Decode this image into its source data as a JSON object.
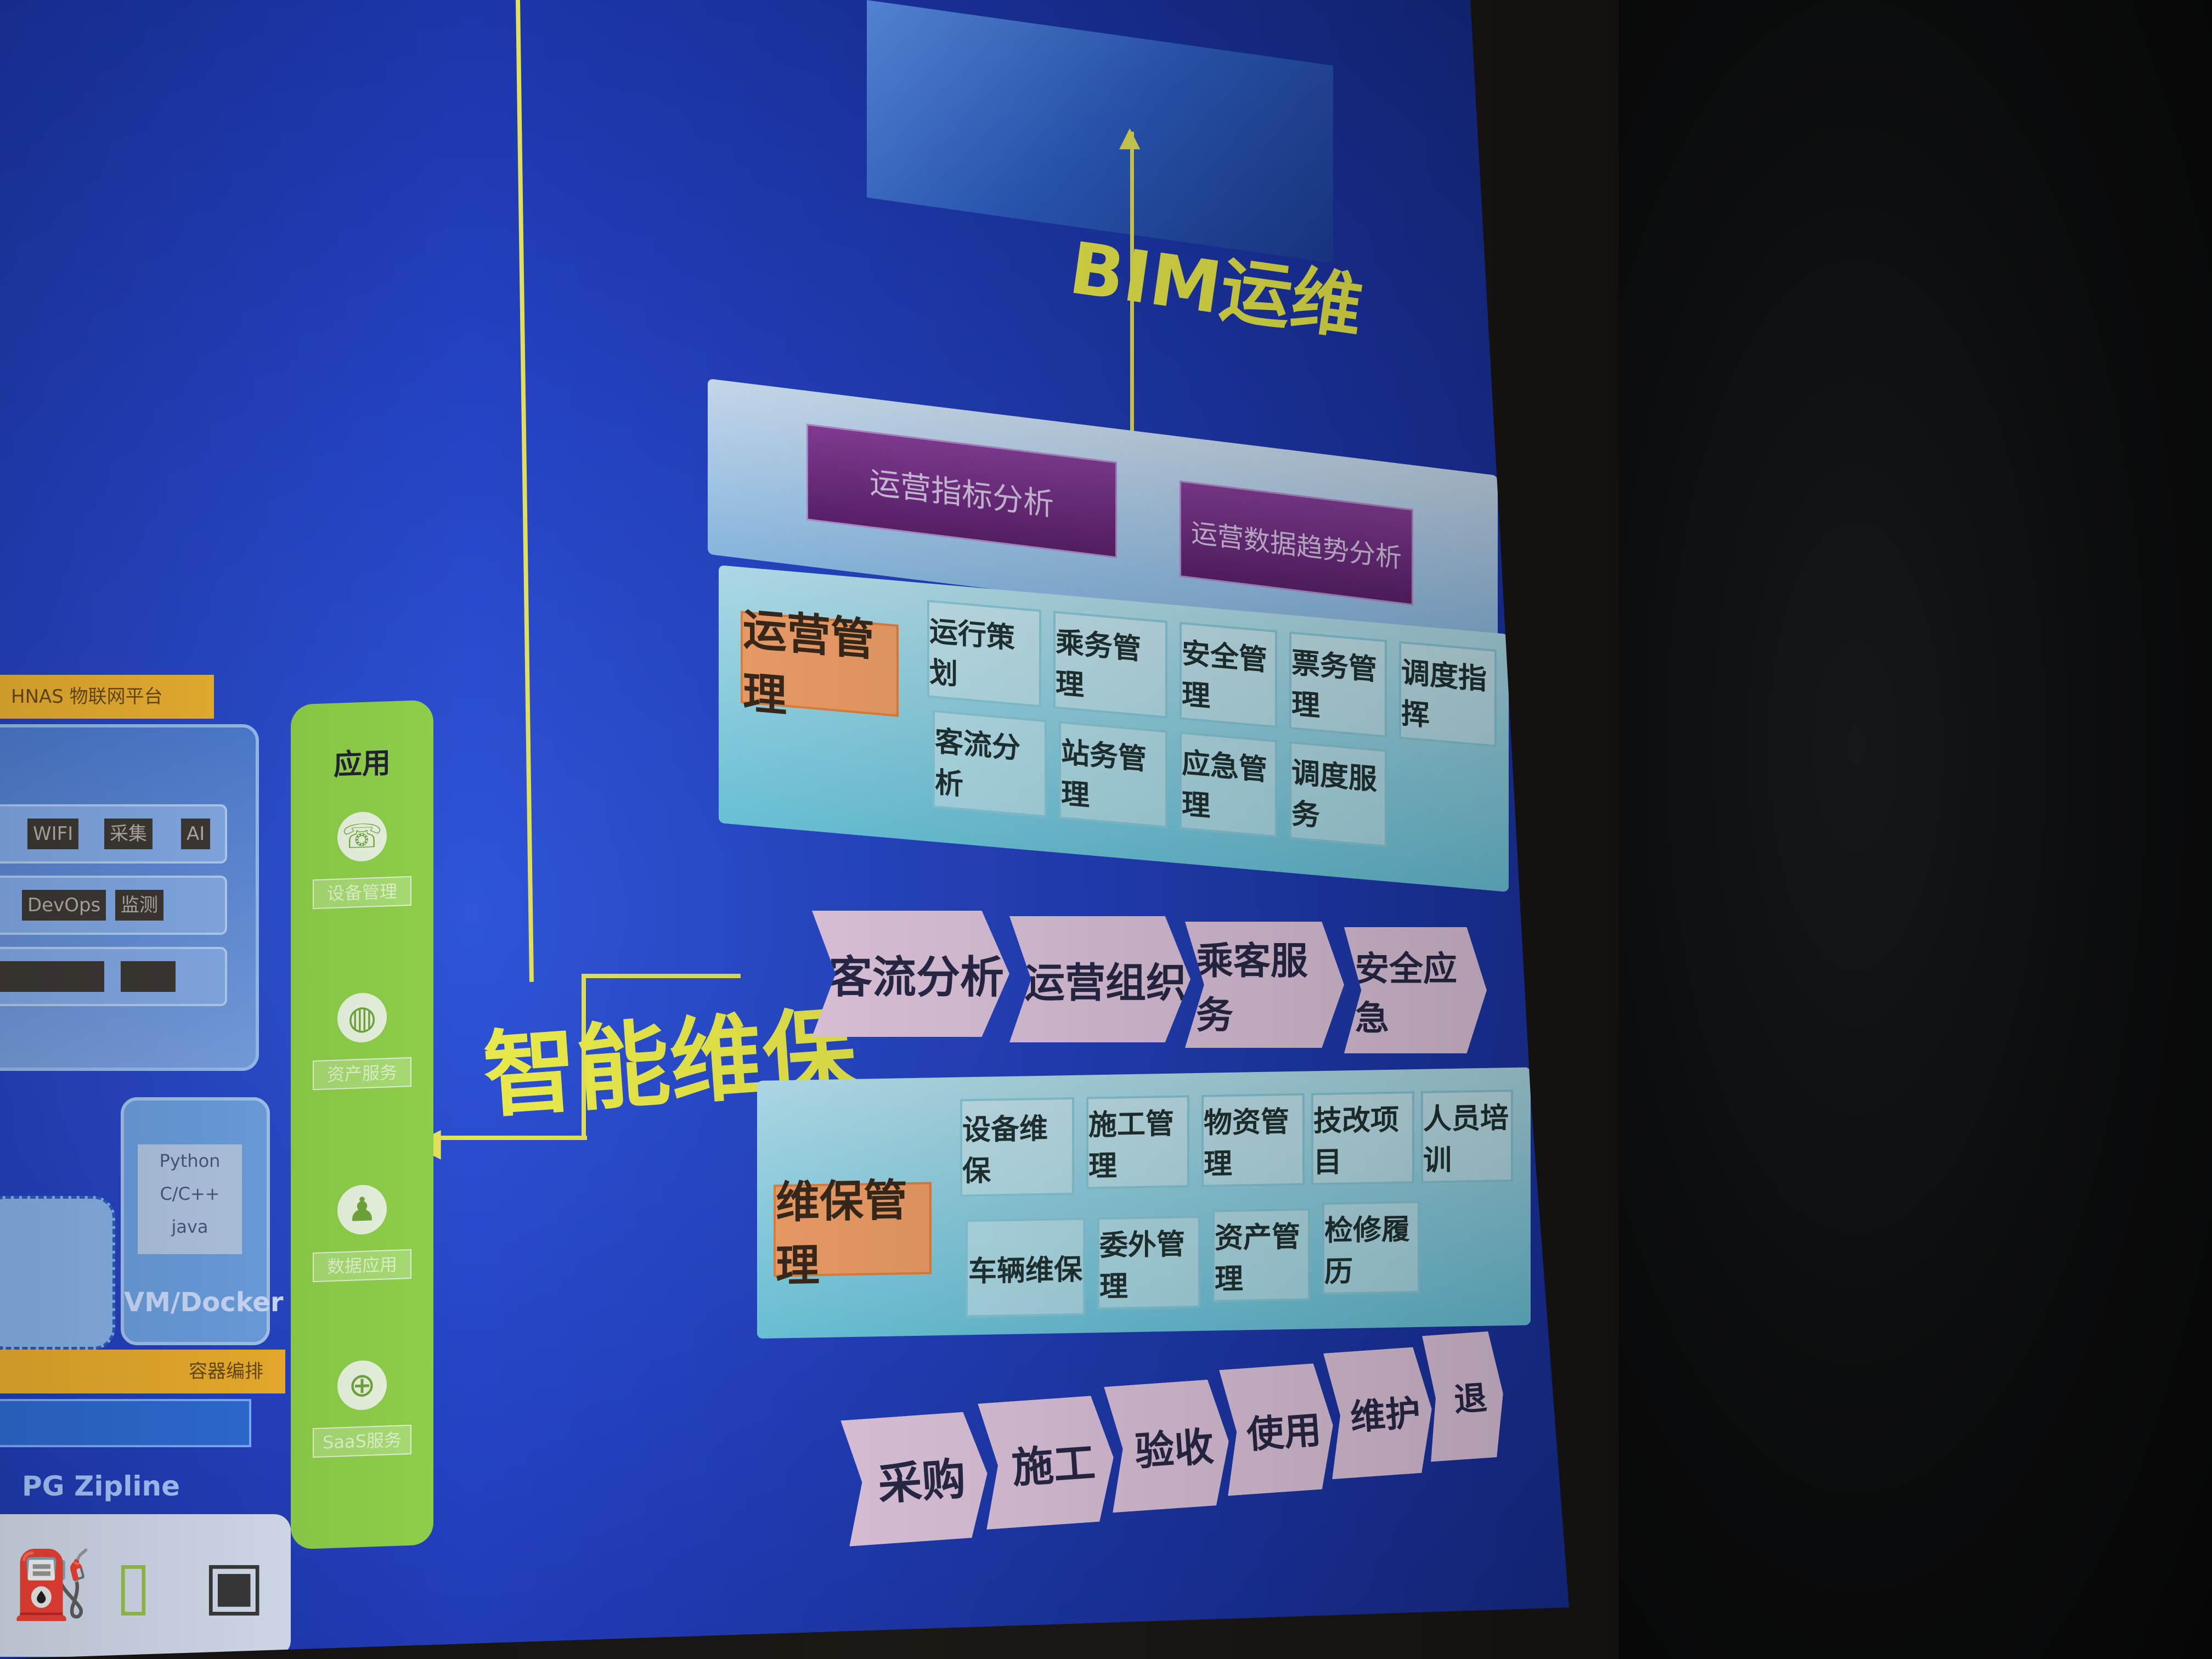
{
  "labels": {
    "bim": "BIM运维",
    "maintenance_flow": "智能维保"
  },
  "top_panel": {
    "items": [
      "运营指标分析",
      "运营数据趋势分析"
    ]
  },
  "operations": {
    "header": "运营管理",
    "row1": [
      "运行策划",
      "乘务管理",
      "安全管理",
      "票务管理",
      "调度指挥"
    ],
    "row2": [
      "客流分析",
      "站务管理",
      "应急管理",
      "调度服务"
    ]
  },
  "chevrons_mid": [
    "客流分析",
    "运营组织",
    "乘客服务",
    "安全应急"
  ],
  "maintenance": {
    "header": "维保管理",
    "row1": [
      "设备维保",
      "施工管理",
      "物资管理",
      "技改项目",
      "人员培训"
    ],
    "row2": [
      "车辆维保",
      "委外管理",
      "资产管理",
      "检修履历"
    ]
  },
  "chevrons_bottom": [
    "采购",
    "施工",
    "验收",
    "使用",
    "维护",
    "退"
  ],
  "app_bar": {
    "title": "应用",
    "items": [
      {
        "icon": "phone-icon",
        "glyph": "☏",
        "label": "设备管理"
      },
      {
        "icon": "globe-icon",
        "glyph": "◍",
        "label": "资产服务"
      },
      {
        "icon": "user-icon",
        "glyph": "♟",
        "label": "数据应用"
      },
      {
        "icon": "earth-icon",
        "glyph": "⊕",
        "label": "SaaS服务"
      }
    ]
  },
  "left_stack": {
    "header": "HNAS  物联网平台",
    "rows": [
      [
        "WIFI",
        "采集",
        "AI"
      ],
      [
        "DevOps",
        "监测"
      ],
      [
        "",
        "",
        ""
      ]
    ],
    "vm_lines": [
      "Python",
      "C/C++",
      "java"
    ],
    "vm_label": "VM/Docker",
    "strip": "容器编排",
    "zip": "PG  Zipline"
  },
  "colors": {
    "slide_blue": "#2443c4",
    "yellow_line": "#e3e25a",
    "purple_box": "#5e2270",
    "orange_box": "#f5a36a",
    "green_bar": "#8fd04a"
  }
}
